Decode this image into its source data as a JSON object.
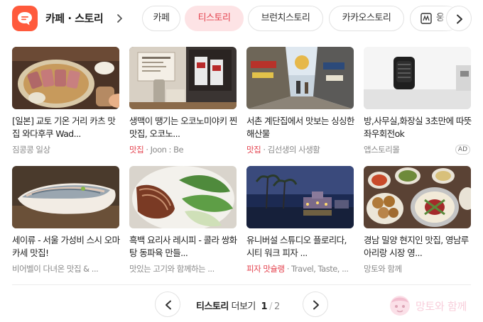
{
  "header": {
    "section_title": "카페 · 스토리",
    "chips": [
      {
        "label": "카페",
        "active": false
      },
      {
        "label": "티스토리",
        "active": true
      },
      {
        "label": "브런치스토리",
        "active": false
      },
      {
        "label": "카카오스토리",
        "active": false
      },
      {
        "label": "웅",
        "active": false
      }
    ],
    "icons": {
      "logo": "speech-bubble-icon",
      "title_arrow": "chevron-right-icon",
      "chip_partial": "tistory-icon",
      "next": "chevron-right-icon"
    }
  },
  "cards": [
    {
      "title": "[일본] 교토 기온 거리 카츠 맛집 와다후쿠 Wad...",
      "source": "",
      "author": "짐콩콩 일상",
      "ad": ""
    },
    {
      "title": "생맥이 땡기는 오코노미야키 찐 맛집, 오코노...",
      "source": "맛집",
      "author": "Joon : Be",
      "ad": ""
    },
    {
      "title": "서촌 계단집에서 맛보는 싱싱한 해산물",
      "source": "맛집",
      "author": "김선생의 사생활",
      "ad": ""
    },
    {
      "title": "방,사무실,화장실 3초만에 따뜻 좌우회전ok",
      "source": "",
      "author": "앱스토리몰",
      "ad": "AD"
    },
    {
      "title": "세이류 - 서울 가성비 스시 오마카세 맛집!",
      "source": "",
      "author": "비어벨이 다녀온 맛집 & ...",
      "ad": ""
    },
    {
      "title": "흑백 요리사 레시피 - 콜라 쌍화탕 동파육 만들...",
      "source": "",
      "author": "맛있는 고기와 함께하는 ...",
      "ad": ""
    },
    {
      "title": "유니버설 스튜디오 플로리다, 시티 워크 피자 ...",
      "source": "피자 맛슐랭",
      "author": "Travel, Taste, ...",
      "ad": ""
    },
    {
      "title": "경남 밀양 현지인 맛집, 영남루 아리랑 시장 영...",
      "source": "",
      "author": "망토와 함께",
      "ad": ""
    }
  ],
  "footer": {
    "more_service": "티스토리",
    "more_word": "더보기",
    "page_current": "1",
    "page_separator": "/",
    "page_total": "2",
    "watermark_text": "망토와 함께"
  },
  "colors": {
    "brand": "#ff5a3c",
    "accent": "#e4434f",
    "chip_active_bg": "#fde3e5"
  }
}
